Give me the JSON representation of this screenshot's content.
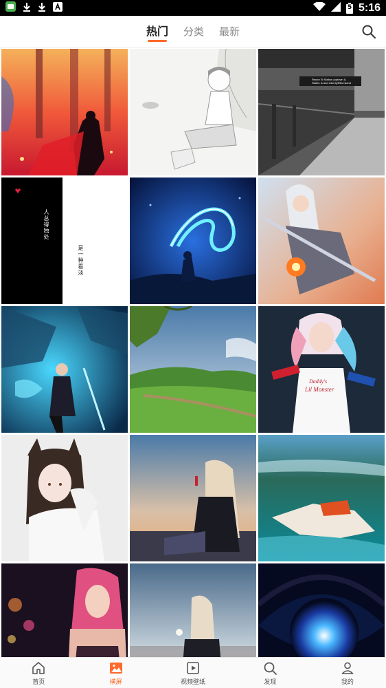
{
  "status_bar": {
    "time": "5:16",
    "battery_level": "5",
    "left_icons": [
      "app-icon",
      "download-icon",
      "download-icon",
      "text-a-icon"
    ],
    "right_icons": [
      "wifi-icon",
      "signal-icon",
      "battery-icon"
    ]
  },
  "header": {
    "tabs": [
      {
        "label": "热门",
        "active": true
      },
      {
        "label": "分类",
        "active": false
      },
      {
        "label": "最新",
        "active": false
      }
    ],
    "search_icon": "search-icon",
    "accent_color": "#ff6a2b"
  },
  "wallpapers": [
    {
      "name": "red-forest-warrior"
    },
    {
      "name": "sketch-boy-under-tree"
    },
    {
      "name": "subway-station-platform",
      "sign_text_1": "Rector St Station (uptown &",
      "sign_text_2": "Staten Is and Liberty/Ellis Island"
    },
    {
      "name": "black-text-wallpaper",
      "text_1": "人总得独处",
      "text_2": "是一种看淡",
      "accent_color": "#e0203a"
    },
    {
      "name": "blue-glowing-figure"
    },
    {
      "name": "white-haired-swordsman"
    },
    {
      "name": "blue-armored-hero"
    },
    {
      "name": "green-hill-landscape"
    },
    {
      "name": "harley-quinn-cosplay",
      "shirt_text_1": "Daddy's",
      "shirt_text_2": "Lil Monster"
    },
    {
      "name": "anime-cat-ear-girl"
    },
    {
      "name": "girl-sunset-city"
    },
    {
      "name": "underwater-swimmer"
    },
    {
      "name": "neon-city-girl"
    },
    {
      "name": "girl-with-dandelion"
    },
    {
      "name": "blue-galaxy-eye"
    }
  ],
  "bottom_nav": [
    {
      "label": "首页",
      "icon": "home-icon",
      "active": false
    },
    {
      "label": "横屏",
      "icon": "image-icon",
      "active": true
    },
    {
      "label": "视频壁纸",
      "icon": "video-icon",
      "active": false
    },
    {
      "label": "发现",
      "icon": "search-icon",
      "active": false
    },
    {
      "label": "我的",
      "icon": "person-icon",
      "active": false
    }
  ]
}
